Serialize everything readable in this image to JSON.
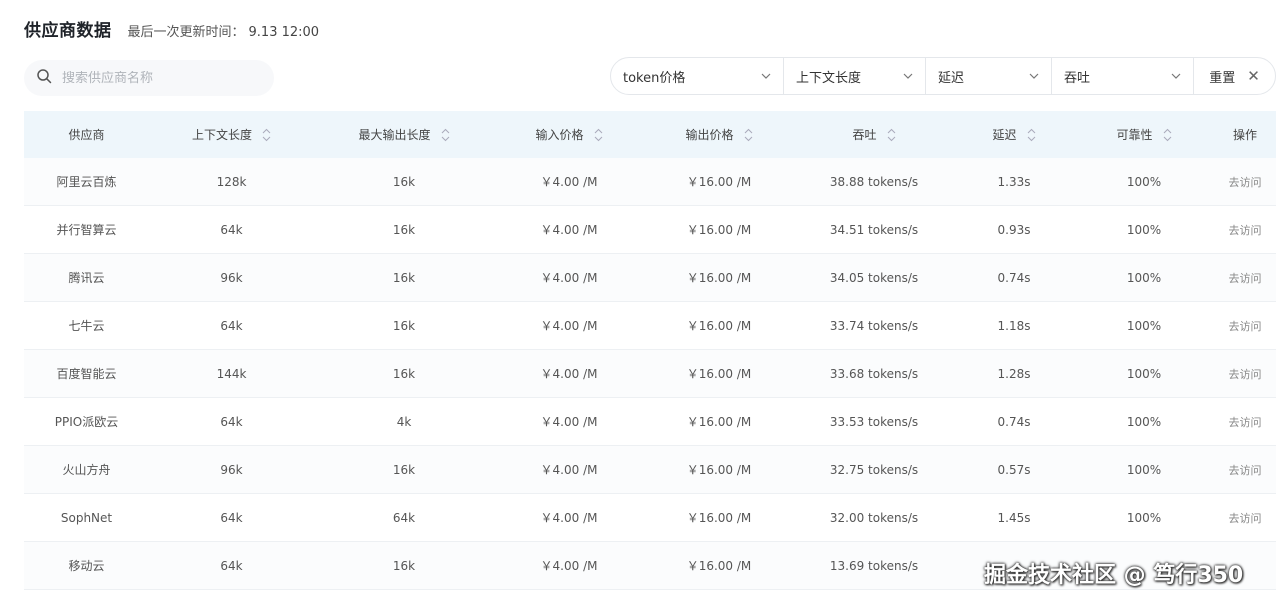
{
  "header": {
    "title": "供应商数据",
    "update_label": "最后一次更新时间：",
    "update_value": "9.13 12:00"
  },
  "search": {
    "placeholder": "搜索供应商名称",
    "value": ""
  },
  "filters": {
    "items": [
      {
        "label": "token价格"
      },
      {
        "label": "上下文长度"
      },
      {
        "label": "延迟"
      },
      {
        "label": "吞吐"
      }
    ],
    "reset_label": "重置"
  },
  "table": {
    "columns": [
      "供应商",
      "上下文长度",
      "最大输出长度",
      "输入价格",
      "输出价格",
      "吞吐",
      "延迟",
      "可靠性",
      "操作"
    ],
    "rows": [
      [
        "阿里云百炼",
        "128k",
        "16k",
        "￥4.00 /M",
        "￥16.00 /M",
        "38.88 tokens/s",
        "1.33s",
        "100%",
        "去访问"
      ],
      [
        "并行智算云",
        "64k",
        "16k",
        "￥4.00 /M",
        "￥16.00 /M",
        "34.51 tokens/s",
        "0.93s",
        "100%",
        "去访问"
      ],
      [
        "腾讯云",
        "96k",
        "16k",
        "￥4.00 /M",
        "￥16.00 /M",
        "34.05 tokens/s",
        "0.74s",
        "100%",
        "去访问"
      ],
      [
        "七牛云",
        "64k",
        "16k",
        "￥4.00 /M",
        "￥16.00 /M",
        "33.74 tokens/s",
        "1.18s",
        "100%",
        "去访问"
      ],
      [
        "百度智能云",
        "144k",
        "16k",
        "￥4.00 /M",
        "￥16.00 /M",
        "33.68 tokens/s",
        "1.28s",
        "100%",
        "去访问"
      ],
      [
        "PPIO派欧云",
        "64k",
        "4k",
        "￥4.00 /M",
        "￥16.00 /M",
        "33.53 tokens/s",
        "0.74s",
        "100%",
        "去访问"
      ],
      [
        "火山方舟",
        "96k",
        "16k",
        "￥4.00 /M",
        "￥16.00 /M",
        "32.75 tokens/s",
        "0.57s",
        "100%",
        "去访问"
      ],
      [
        "SophNet",
        "64k",
        "64k",
        "￥4.00 /M",
        "￥16.00 /M",
        "32.00 tokens/s",
        "1.45s",
        "100%",
        "去访问"
      ],
      [
        "移动云",
        "64k",
        "16k",
        "￥4.00 /M",
        "￥16.00 /M",
        "13.69 tokens/s",
        "",
        "",
        ""
      ]
    ]
  },
  "watermark": {
    "text": "掘金技术社区 @ 笃行350"
  },
  "colors": {
    "header_bg": "#eef6fb",
    "border": "#e4e7eb",
    "title": "#1f2329"
  }
}
